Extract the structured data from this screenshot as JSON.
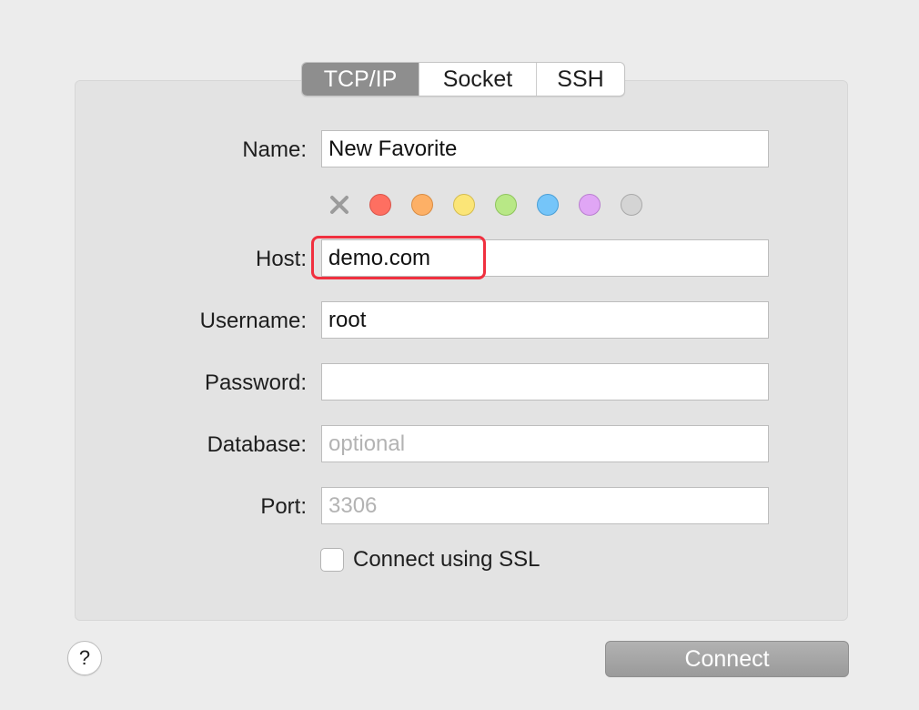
{
  "tabs": [
    {
      "label": "TCP/IP",
      "active": true
    },
    {
      "label": "Socket",
      "active": false
    },
    {
      "label": "SSH",
      "active": false
    }
  ],
  "form": {
    "name": {
      "label": "Name:",
      "value": "New Favorite"
    },
    "host": {
      "label": "Host:",
      "value": "demo.com"
    },
    "username": {
      "label": "Username:",
      "value": "root"
    },
    "password": {
      "label": "Password:",
      "value": ""
    },
    "database": {
      "label": "Database:",
      "placeholder": "optional"
    },
    "port": {
      "label": "Port:",
      "placeholder": "3306"
    }
  },
  "color_tags": {
    "clear_icon": "x-icon",
    "colors": [
      {
        "name": "red",
        "fill": "#fe6f61",
        "stroke": "#d9544a"
      },
      {
        "name": "orange",
        "fill": "#fdb066",
        "stroke": "#d98c42"
      },
      {
        "name": "yellow",
        "fill": "#fbe577",
        "stroke": "#d4bc50"
      },
      {
        "name": "green",
        "fill": "#b8e886",
        "stroke": "#8fc45d"
      },
      {
        "name": "blue",
        "fill": "#75c5f9",
        "stroke": "#4a9fd6"
      },
      {
        "name": "purple",
        "fill": "#e0a6f5",
        "stroke": "#b97ed0"
      },
      {
        "name": "gray",
        "fill": "#d4d4d4",
        "stroke": "#a8a8a8"
      }
    ]
  },
  "ssl": {
    "label": "Connect using SSL",
    "checked": false
  },
  "help_button": {
    "label": "?"
  },
  "connect_button": {
    "label": "Connect"
  },
  "highlight_color": "#f0303f"
}
